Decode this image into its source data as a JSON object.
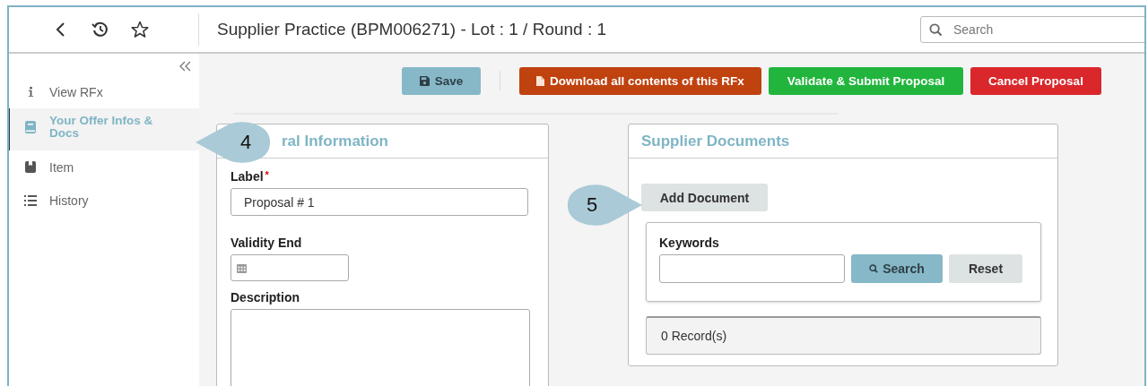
{
  "header": {
    "title": "Supplier Practice (BPM006271) - Lot : 1 / Round : 1",
    "search": {
      "placeholder": "Search"
    }
  },
  "sidebar": {
    "items": [
      {
        "label": "View RFx",
        "kind": "info",
        "selected": false
      },
      {
        "label": "Your Offer Infos & Docs",
        "kind": "book",
        "selected": true
      },
      {
        "label": "Item",
        "kind": "box",
        "selected": false
      },
      {
        "label": "History",
        "kind": "list",
        "selected": false
      }
    ]
  },
  "toolbar": {
    "buttons": [
      {
        "label": "Save",
        "kind": "save"
      },
      {
        "label": "Download all contents of this RFx",
        "kind": "download"
      },
      {
        "label": "Validate & Submit Proposal",
        "kind": "validate"
      },
      {
        "label": "Cancel Proposal",
        "kind": "cancel"
      }
    ]
  },
  "general_card": {
    "title": "ral Information",
    "label_field": {
      "label": "Label",
      "required": true,
      "required_mark": "*",
      "value": "Proposal # 1"
    },
    "validity_end": {
      "label": "Validity End"
    },
    "description": {
      "label": "Description"
    }
  },
  "documents_card": {
    "title": "Supplier Documents",
    "add_button": "Add Document",
    "keywords": {
      "label": "Keywords"
    },
    "search_button": "Search",
    "reset_button": "Reset",
    "records": "0 Record(s)"
  },
  "callouts": [
    {
      "number": "4"
    },
    {
      "number": "5"
    }
  ]
}
